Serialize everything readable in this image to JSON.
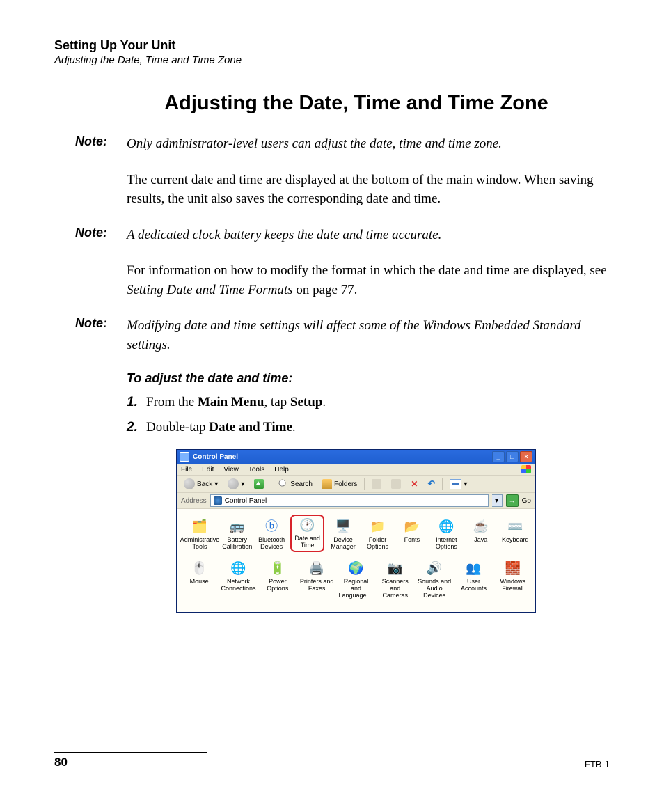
{
  "header": {
    "chapter": "Setting Up Your Unit",
    "section": "Adjusting the Date, Time and Time Zone"
  },
  "heading": "Adjusting the Date, Time and Time Zone",
  "notes": {
    "label": "Note:",
    "n1": "Only administrator-level users can adjust the date, time and time zone.",
    "n2": "A dedicated clock battery keeps the date and time accurate.",
    "n3": "Modifying date and time settings will affect some of the Windows Embedded Standard settings."
  },
  "paras": {
    "p1": "The current date and time are displayed at the bottom of the main window. When saving results, the unit also saves the corresponding date and time.",
    "p2_a": "For information on how to modify the format in which the date and time are displayed, see ",
    "p2_ref": "Setting Date and Time Formats",
    "p2_b": " on page 77."
  },
  "procedure": {
    "title": "To adjust the date and time:",
    "steps": [
      {
        "num": "1.",
        "a": "From the ",
        "b1": "Main Menu",
        "c": ", tap ",
        "b2": "Setup",
        "d": "."
      },
      {
        "num": "2.",
        "a": "Double-tap ",
        "b1": "Date and Time",
        "c": ".",
        "b2": "",
        "d": ""
      }
    ]
  },
  "screenshot": {
    "title": "Control Panel",
    "menus": [
      "File",
      "Edit",
      "View",
      "Tools",
      "Help"
    ],
    "toolbar": {
      "back": "Back",
      "search": "Search",
      "folders": "Folders"
    },
    "address_label": "Address",
    "address_value": "Control Panel",
    "go_label": "Go",
    "items_row1": [
      "Administrative Tools",
      "Battery Calibration",
      "Bluetooth Devices",
      "Date and Time",
      "Device Manager",
      "Folder Options",
      "Fonts",
      "Internet Options",
      "Java",
      "Keyboard"
    ],
    "items_row2": [
      "Mouse",
      "Network Connections",
      "Power Options",
      "Printers and Faxes",
      "Regional and Language ...",
      "Scanners and Cameras",
      "Sounds and Audio Devices",
      "User Accounts",
      "Windows Firewall"
    ],
    "highlight_index_row1": 3
  },
  "footer": {
    "page": "80",
    "docid": "FTB-1"
  }
}
